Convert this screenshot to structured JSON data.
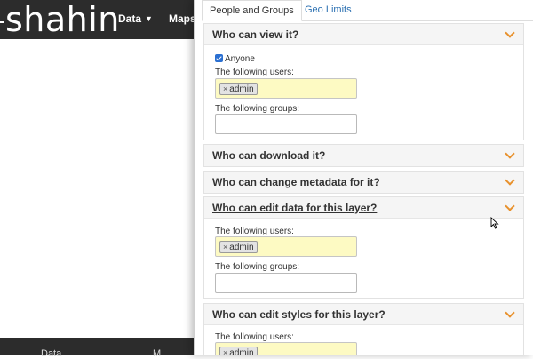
{
  "app": {
    "brand": "shahin",
    "nav": [
      {
        "label": "Data"
      },
      {
        "label": "Maps"
      }
    ],
    "footer": [
      "Data",
      "M"
    ]
  },
  "tabs": [
    {
      "label": "People and Groups",
      "active": true
    },
    {
      "label": "Geo Limits",
      "active": false
    }
  ],
  "sections": {
    "view": {
      "title": "Who can view it?",
      "anyone_label": "Anyone",
      "anyone_checked": true,
      "users_label": "The following users:",
      "users": [
        "admin"
      ],
      "groups_label": "The following groups:",
      "groups": []
    },
    "download": {
      "title": "Who can download it?"
    },
    "metadata": {
      "title": "Who can change metadata for it?"
    },
    "edit_data": {
      "title": "Who can edit data for this layer?",
      "users_label": "The following users:",
      "users": [
        "admin"
      ],
      "groups_label": "The following groups:",
      "groups": []
    },
    "edit_styles": {
      "title": "Who can edit styles for this layer?",
      "users_label": "The following users:",
      "users": [
        "admin"
      ]
    }
  },
  "tag_remove_glyph": "×",
  "colors": {
    "accent_chevron": "#e8912d",
    "tag_input_bg": "#fdfac3",
    "link": "#2a6fb1",
    "navbar": "#2c2c2c"
  }
}
